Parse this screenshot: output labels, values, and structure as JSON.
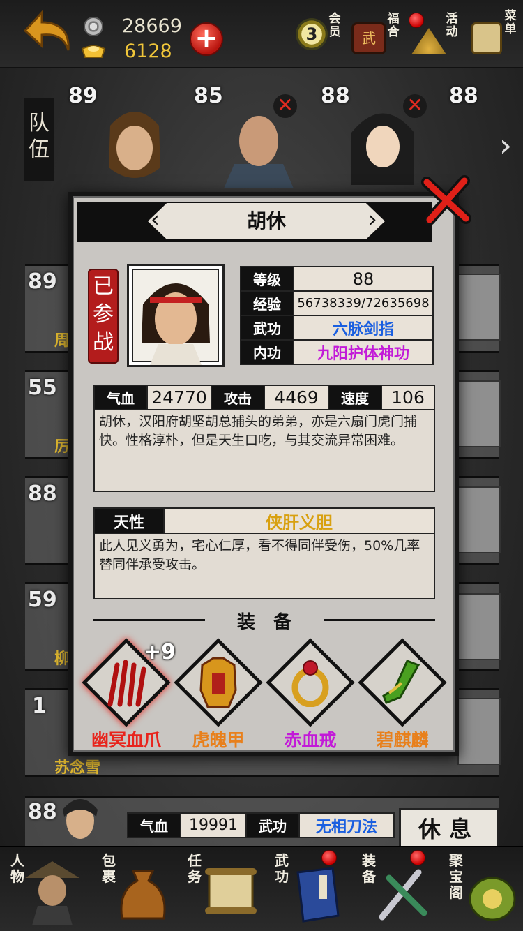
{
  "topbar": {
    "silver": "28669",
    "gold": "6128",
    "vip_level": "3",
    "icons": [
      {
        "label": "会员",
        "icon": "vip-badge-icon"
      },
      {
        "label": "福合",
        "icon": "gift-box-icon"
      },
      {
        "label": "活动",
        "icon": "hat-icon"
      },
      {
        "label": "菜单",
        "icon": "scroll-icon"
      }
    ]
  },
  "team": {
    "label": "队伍",
    "members": [
      {
        "level": "89"
      },
      {
        "level": "85",
        "removable": true
      },
      {
        "level": "88",
        "removable": true
      },
      {
        "level": "88"
      }
    ]
  },
  "list": [
    {
      "level": "89",
      "name_fragment": "周"
    },
    {
      "level": "55",
      "name_fragment": "厉"
    },
    {
      "level": "88"
    },
    {
      "level": "59",
      "name_fragment": "柳"
    },
    {
      "level": "1",
      "name_fragment": "苏念雪"
    },
    {
      "level": "88"
    }
  ],
  "bottom_row": {
    "hp_label": "气血",
    "hp": "19991",
    "skill_label": "武功",
    "skill": "无相刀法",
    "button": "休息"
  },
  "modal": {
    "name": "胡休",
    "deployed_badge": "已参战",
    "info": {
      "level_label": "等级",
      "level": "88",
      "exp_label": "经验",
      "exp": "56738339/72635698",
      "skill_label": "武功",
      "skill": "六脉剑指",
      "inner_label": "内功",
      "inner": "九阳护体神功"
    },
    "stats": {
      "hp_label": "气血",
      "hp": "24770",
      "atk_label": "攻击",
      "atk": "4469",
      "spd_label": "速度",
      "spd": "106"
    },
    "bio": "胡休，汉阳府胡坚胡总捕头的弟弟，亦是六扇门虎门捕快。性格淳朴，但是天生口吃，与其交流异常困难。",
    "trait": {
      "label": "天性",
      "name": "侠肝义胆",
      "desc": "此人见义勇为，宅心仁厚，看不得同伴受伤，50%几率替同伴承受攻击。"
    },
    "equipment_title": "装　备",
    "equipment": [
      {
        "name": "幽冥血爪",
        "enhance": "+9",
        "color": "#e8241c",
        "icon": "blood-claw-icon"
      },
      {
        "name": "虎魄甲",
        "color": "#e8801c",
        "icon": "tiger-armor-icon"
      },
      {
        "name": "赤血戒",
        "color": "#c21ad8",
        "icon": "red-ring-icon"
      },
      {
        "name": "碧麒麟",
        "color": "#e8801c",
        "icon": "jade-boots-icon"
      }
    ]
  },
  "nav": [
    {
      "label": "人物",
      "icon": "hero-icon"
    },
    {
      "label": "包裹",
      "icon": "bag-icon"
    },
    {
      "label": "任务",
      "icon": "task-scroll-icon"
    },
    {
      "label": "武功",
      "icon": "skill-book-icon",
      "badge": true
    },
    {
      "label": "装备",
      "icon": "equipment-icon",
      "badge": true
    },
    {
      "label": "聚宝阁",
      "icon": "treasure-icon"
    }
  ],
  "colors": {
    "skill_blue": "#1a5fe0",
    "inner_purple": "#c21ad8",
    "trait_gold": "#d8a010",
    "modal_bg": "#c9c6c2"
  }
}
